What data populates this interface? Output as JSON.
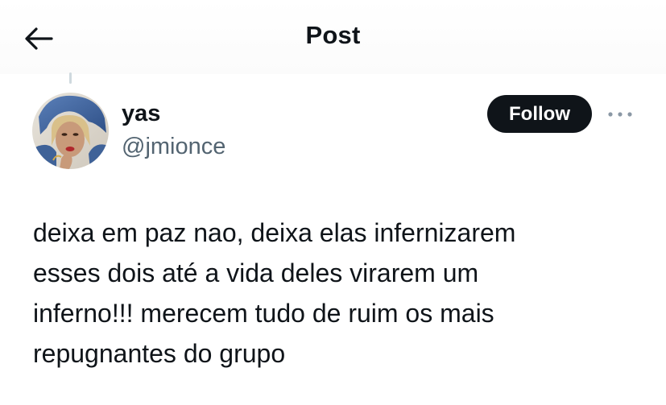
{
  "header": {
    "title": "Post",
    "back_icon": "arrow-left-icon"
  },
  "author": {
    "display_name": "yas",
    "handle": "@jmionce",
    "avatar_icon": "profile-photo"
  },
  "actions": {
    "follow_label": "Follow",
    "more_icon": "ellipsis-icon"
  },
  "post": {
    "text": "deixa em paz nao, deixa elas infernizarem\nesses dois até a vida deles virarem um\ninferno!!! merecem tudo de ruim os mais\nrepugnantes do grupo"
  },
  "colors": {
    "text_primary": "#0f1419",
    "text_secondary": "#536471",
    "button_bg": "#0f1419",
    "button_text": "#ffffff",
    "divider": "#cfd9de"
  }
}
